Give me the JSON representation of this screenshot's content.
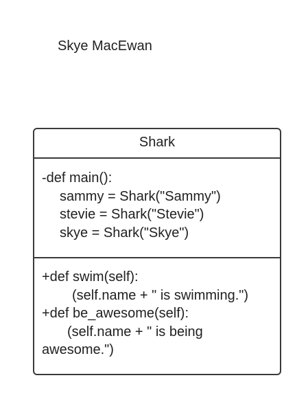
{
  "author": "Skye MacEwan",
  "uml_class": {
    "name": "Shark",
    "attributes": [
      "-def main():",
      "sammy = Shark(\"Sammy\")",
      "stevie = Shark(\"Stevie\")",
      "skye = Shark(\"Skye\")"
    ],
    "operations": [
      "+def swim(self):",
      "(self.name + \" is swimming.\")",
      "+def be_awesome(self):",
      "(self.name + \" is being",
      "awesome.\")"
    ]
  }
}
